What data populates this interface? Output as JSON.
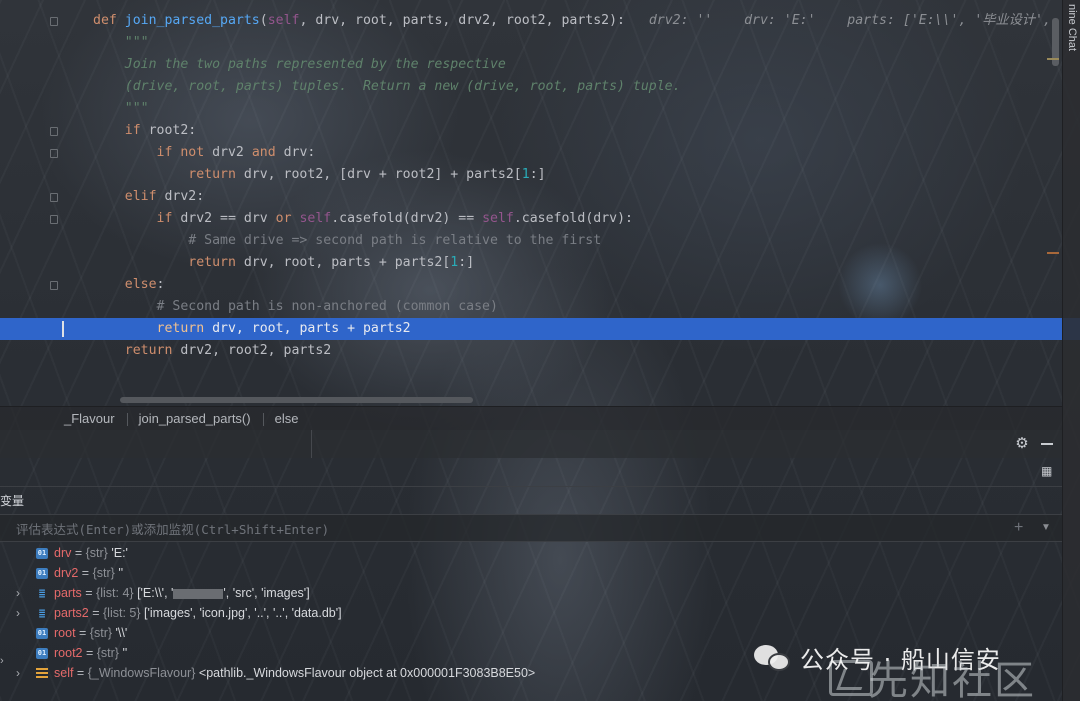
{
  "editor": {
    "lines": [
      [
        [
          "kw",
          "def "
        ],
        [
          "fn",
          "join_parsed_parts"
        ],
        [
          "param",
          "("
        ],
        [
          "self",
          "self"
        ],
        [
          "param",
          ", drv, root, parts, drv2, root2, parts2):  "
        ],
        [
          "hint",
          " drv2: ''    drv: 'E:'    parts: ['E:\\\\', '毕业设计', "
        ]
      ],
      [
        [
          "doc",
          "    \"\"\""
        ]
      ],
      [
        [
          "doc",
          "    Join the two paths represented by the respective"
        ]
      ],
      [
        [
          "doc",
          "    (drive, root, parts) tuples.  Return a new (drive, root, parts) tuple."
        ]
      ],
      [
        [
          "doc",
          "    \"\"\""
        ]
      ],
      [
        [
          "param",
          "    "
        ],
        [
          "kw",
          "if "
        ],
        [
          "param",
          "root2:"
        ]
      ],
      [
        [
          "param",
          "        "
        ],
        [
          "kw",
          "if not "
        ],
        [
          "param",
          "drv2 "
        ],
        [
          "kw",
          "and "
        ],
        [
          "param",
          "drv:"
        ]
      ],
      [
        [
          "param",
          "            "
        ],
        [
          "kw",
          "return "
        ],
        [
          "param",
          "drv, root2, [drv + root2] + parts2["
        ],
        [
          "num",
          "1"
        ],
        [
          "param",
          ":]"
        ]
      ],
      [
        [
          "param",
          "    "
        ],
        [
          "kw",
          "elif "
        ],
        [
          "param",
          "drv2:"
        ]
      ],
      [
        [
          "param",
          "        "
        ],
        [
          "kw",
          "if "
        ],
        [
          "param",
          "drv2 == drv "
        ],
        [
          "kw",
          "or "
        ],
        [
          "self",
          "self"
        ],
        [
          "param",
          ".casefold(drv2) == "
        ],
        [
          "self",
          "self"
        ],
        [
          "param",
          ".casefold(drv):"
        ]
      ],
      [
        [
          "cmt",
          "            # Same drive => second path is relative to the first"
        ]
      ],
      [
        [
          "param",
          "            "
        ],
        [
          "kw",
          "return "
        ],
        [
          "param",
          "drv, root, parts + parts2["
        ],
        [
          "num",
          "1"
        ],
        [
          "param",
          ":]"
        ]
      ],
      [
        [
          "param",
          "    "
        ],
        [
          "kw",
          "else"
        ],
        [
          "param",
          ":"
        ]
      ],
      [
        [
          "cmt",
          "        # Second path is non-anchored (common case)"
        ]
      ],
      [
        [
          "param",
          "        "
        ],
        [
          "kw",
          "return "
        ],
        [
          "param",
          "drv, root, parts + parts2"
        ]
      ],
      [
        [
          "param",
          "    "
        ],
        [
          "kw",
          "return "
        ],
        [
          "param",
          "drv2, root2, parts2"
        ]
      ]
    ],
    "active_line": 14
  },
  "right_strip_label": "nine Chat",
  "breadcrumb": [
    "_Flavour",
    "join_parsed_parts()",
    "else"
  ],
  "panel": {
    "vars_title": "变量",
    "eval_placeholder": "评估表达式(Enter)或添加监视(Ctrl+Shift+Enter)",
    "eval_add": "+"
  },
  "variables": [
    {
      "name": "drv",
      "icon": "prim",
      "icon_text": "01",
      "expandable": false,
      "type": "{str}",
      "value": "'E:'"
    },
    {
      "name": "drv2",
      "icon": "prim",
      "icon_text": "01",
      "expandable": false,
      "type": "{str}",
      "value": "''"
    },
    {
      "name": "parts",
      "icon": "list",
      "icon_text": "≣",
      "expandable": true,
      "type": "{list: 4}",
      "value_pre": "['E:\\\\', '",
      "redacted": true,
      "value_post": "', 'src', 'images']"
    },
    {
      "name": "parts2",
      "icon": "list",
      "icon_text": "≣",
      "expandable": true,
      "type": "{list: 5}",
      "value": "['images', 'icon.jpg', '..', '..', 'data.db']"
    },
    {
      "name": "root",
      "icon": "prim",
      "icon_text": "01",
      "expandable": false,
      "type": "{str}",
      "value": "'\\\\'"
    },
    {
      "name": "root2",
      "icon": "prim",
      "icon_text": "01",
      "expandable": false,
      "type": "{str}",
      "value": "''"
    },
    {
      "name": "self",
      "icon": "obj",
      "icon_text": "",
      "expandable": true,
      "type": "{_WindowsFlavour}",
      "value": "<pathlib._WindowsFlavour object at 0x000001F3083B8E50>"
    }
  ],
  "watermark": {
    "account_text": "公众号 · 船山信安",
    "site_text": "先知社区"
  },
  "colors": {
    "selection": "#2f65ca",
    "keyword": "#cf8e6d",
    "function": "#56a8f5",
    "docstring": "#5f826b",
    "var_name": "#e56a6a"
  }
}
